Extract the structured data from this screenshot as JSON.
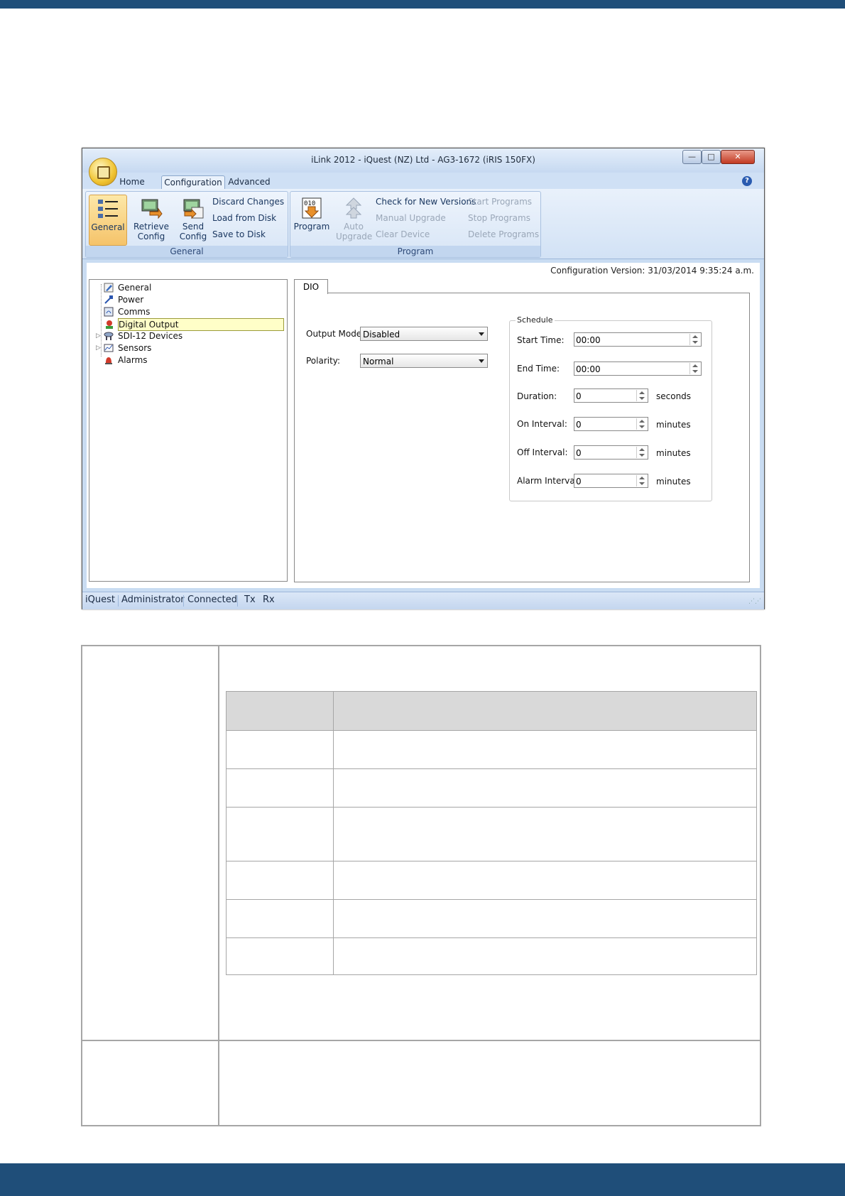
{
  "window": {
    "title": "iLink 2012 - iQuest (NZ) Ltd - AG3-1672 (iRIS 150FX)",
    "controls": {
      "minimize": "—",
      "maximize": "□",
      "close": "✕"
    }
  },
  "ribbon_tabs": [
    "Home",
    "Configuration",
    "Advanced"
  ],
  "ribbon": {
    "general_group": {
      "label": "General",
      "general_button": "General",
      "retrieve_button": "Retrieve\nConfig",
      "send_button": "Send\nConfig",
      "discard": "Discard Changes",
      "load": "Load from Disk",
      "save": "Save to Disk"
    },
    "program_group": {
      "label": "Program",
      "program_button": "Program",
      "auto_upgrade_button": "Auto\nUpgrade",
      "check_versions": "Check for New Versions",
      "manual_upgrade": "Manual Upgrade",
      "clear_device": "Clear Device",
      "start_programs": "Start Programs",
      "stop_programs": "Stop Programs",
      "delete_programs": "Delete Programs"
    }
  },
  "config_version": "Configuration Version: 31/03/2014 9:35:24 a.m.",
  "tree": [
    "General",
    "Power",
    "Comms",
    "Digital Output",
    "SDI-12 Devices",
    "Sensors",
    "Alarms"
  ],
  "panel": {
    "tab": "DIO",
    "output_mode_label": "Output Mode:",
    "output_mode_value": "Disabled",
    "polarity_label": "Polarity:",
    "polarity_value": "Normal",
    "schedule": {
      "title": "Schedule",
      "start_time_label": "Start Time:",
      "start_time_value": "00:00",
      "end_time_label": "End Time:",
      "end_time_value": "00:00",
      "duration_label": "Duration:",
      "duration_value": "0",
      "duration_unit": "seconds",
      "on_interval_label": "On Interval:",
      "on_interval_value": "0",
      "on_interval_unit": "minutes",
      "off_interval_label": "Off Interval:",
      "off_interval_value": "0",
      "off_interval_unit": "minutes",
      "alarm_interval_label": "Alarm Interval:",
      "alarm_interval_value": "0",
      "alarm_interval_unit": "minutes"
    }
  },
  "statusbar": [
    "iQuest",
    "Administrator",
    "Connected",
    "Tx",
    "Rx"
  ],
  "colors": {
    "band": "#1f4e79",
    "ribbon_selected": "#f5c36a",
    "tree_selected": "#fffec8"
  }
}
